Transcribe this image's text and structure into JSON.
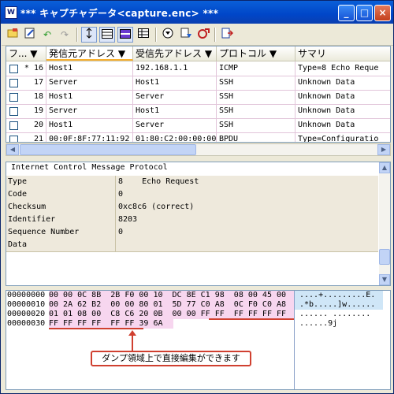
{
  "window": {
    "title": "*** キャプチャデータ<capture.enc> ***",
    "icon_letter": "W",
    "minimize": "_",
    "maximize": "□",
    "close": "×"
  },
  "toolbar": {
    "icons": [
      "open-icon",
      "edit-icon",
      "undo-icon",
      "redo-icon",
      "fit-icon",
      "list-view-icon",
      "split-view-icon",
      "table-view-icon",
      "down-circle-icon",
      "filter-icon",
      "stop-icon",
      "export-icon"
    ]
  },
  "columns": [
    {
      "label": "フ...",
      "sort": "▼"
    },
    {
      "label": "発信元アドレス",
      "sort": "▼"
    },
    {
      "label": "受信先アドレス",
      "sort": "▼"
    },
    {
      "label": "プロトコル",
      "sort": "▼"
    },
    {
      "label": "サマリ",
      "sort": ""
    }
  ],
  "packets": [
    {
      "num": "* 16",
      "src": "Host1",
      "dst": "192.168.1.1",
      "proto": "ICMP",
      "summary": "Type=8 Echo Reque"
    },
    {
      "num": "17",
      "src": "Server",
      "dst": "Host1",
      "proto": "SSH",
      "summary": "Unknown Data"
    },
    {
      "num": "18",
      "src": "Host1",
      "dst": "Server",
      "proto": "SSH",
      "summary": "Unknown Data"
    },
    {
      "num": "19",
      "src": "Server",
      "dst": "Host1",
      "proto": "SSH",
      "summary": "Unknown Data"
    },
    {
      "num": "20",
      "src": "Host1",
      "dst": "Server",
      "proto": "SSH",
      "summary": "Unknown Data"
    },
    {
      "num": "21",
      "src": "00:0F:8F:77:11:92",
      "dst": "01:80:C2:00:00:00",
      "proto": "BPDU",
      "summary": "Type=Configuratio"
    }
  ],
  "detail": {
    "protocol": "Internet Control Message Protocol",
    "fields": [
      {
        "name": "Type",
        "value": "8    Echo Request"
      },
      {
        "name": "Code",
        "value": "0"
      },
      {
        "name": "Checksum",
        "value": "0xc8c6 (correct)"
      },
      {
        "name": "Identifier",
        "value": "8203"
      },
      {
        "name": "Sequence Number",
        "value": "0"
      },
      {
        "name": "Data",
        "value": ""
      }
    ]
  },
  "hexdump": {
    "offsets": [
      "00000000",
      "00000010",
      "00000020",
      "00000030"
    ],
    "lines": [
      "00 00 0C 8B  2B F0 00 10  DC 8E C1 98  08 00 45 00",
      "00 2A 62 B2  00 00 80 01  5D 77 C0 A8  0C F0 C0 A8",
      "01 01 08 00  C8 C6 20 0B  00 00 FF FF  FF FF FF FF",
      "FF FF FF FF  FF FF 39 6A"
    ],
    "ascii": [
      "....+.........E.",
      ".*b.....]w......",
      "...... ........",
      "......9j"
    ]
  },
  "callout": {
    "text": "ダンプ領域上で直接編集ができます"
  },
  "colors": {
    "accent": "#d04030",
    "row_border": "#e2c5da",
    "hex_pink": "#f7d6ef",
    "hex_blue": "#cfe6f7"
  }
}
